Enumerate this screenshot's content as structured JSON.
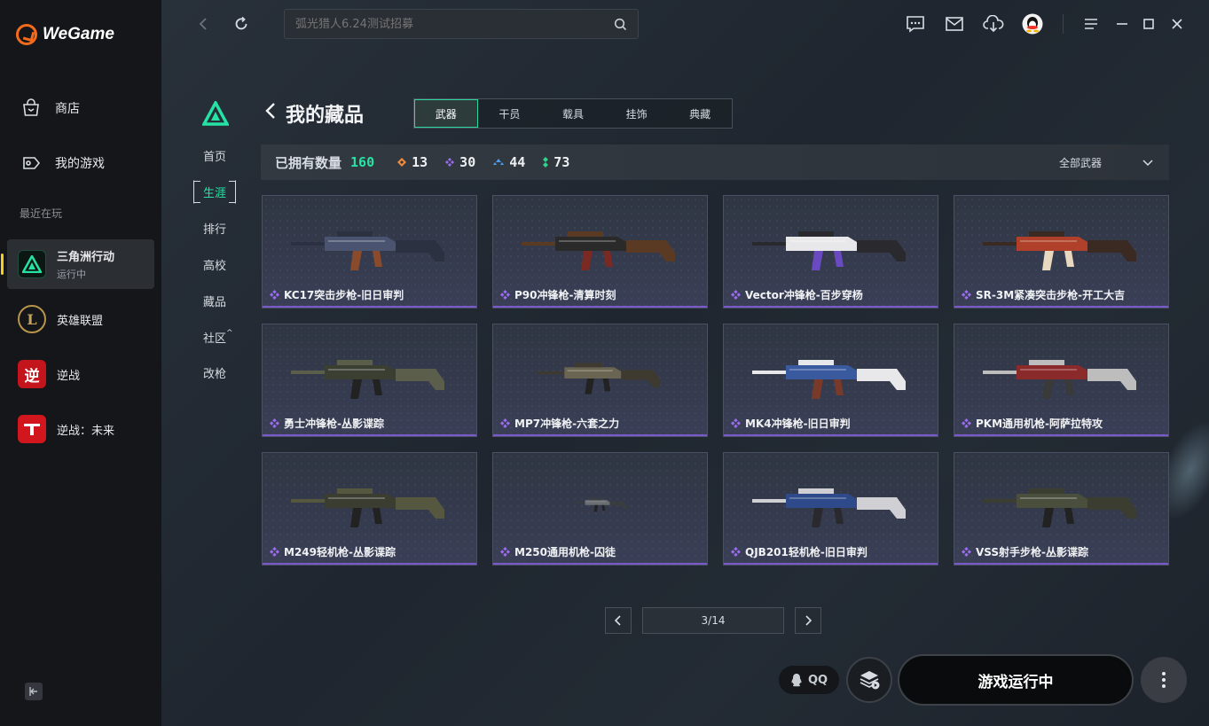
{
  "app": {
    "name": "WeGame",
    "brand_color": "#f56a1b",
    "accent": "#25e3a4"
  },
  "sidebar": {
    "nav": [
      {
        "label": "商店",
        "icon": "store-bag-icon"
      },
      {
        "label": "我的游戏",
        "icon": "gamepad-icon"
      }
    ],
    "recent_label": "最近在玩",
    "games": [
      {
        "name": "三角洲行动",
        "status": "运行中",
        "active": true
      },
      {
        "name": "英雄联盟"
      },
      {
        "name": "逆战"
      },
      {
        "name": "逆战：未来"
      }
    ]
  },
  "topbar": {
    "search_placeholder": "弧光猎人6.24测试招募"
  },
  "subnav": {
    "items": [
      "首页",
      "生涯",
      "排行",
      "高校",
      "藏品",
      "社区",
      "改枪"
    ],
    "active": "生涯"
  },
  "page": {
    "title": "我的藏品",
    "tabs": [
      "武器",
      "干员",
      "载具",
      "挂饰",
      "典藏"
    ],
    "active_tab": "武器"
  },
  "stats": {
    "owned_label": "已拥有数量",
    "total": "160",
    "counts": [
      {
        "value": "13",
        "color": "#f08a3c"
      },
      {
        "value": "30",
        "color": "#9b6cf0"
      },
      {
        "value": "44",
        "color": "#4a9ef0"
      },
      {
        "value": "73",
        "color": "#2fd28a"
      }
    ],
    "filter": "全部武器"
  },
  "items": [
    {
      "name": "KC17突击步枪-旧日审判"
    },
    {
      "name": "P90冲锋枪-清算时刻"
    },
    {
      "name": "Vector冲锋枪-百步穿杨"
    },
    {
      "name": "SR-3M紧凑突击步枪-开工大吉"
    },
    {
      "name": "勇士冲锋枪-丛影谍踪"
    },
    {
      "name": "MP7冲锋枪-六套之力"
    },
    {
      "name": "MK4冲锋枪-旧日审判"
    },
    {
      "name": "PKM通用机枪-阿萨拉特攻"
    },
    {
      "name": "M249轻机枪-丛影谍踪"
    },
    {
      "name": "M250通用机枪-囚徒"
    },
    {
      "name": "QJB201轻机枪-旧日审判"
    },
    {
      "name": "VSS射手步枪-丛影谍踪"
    }
  ],
  "pagination": {
    "label": "3/14"
  },
  "footer": {
    "qq_label": "QQ",
    "run_label": "游戏运行中"
  }
}
